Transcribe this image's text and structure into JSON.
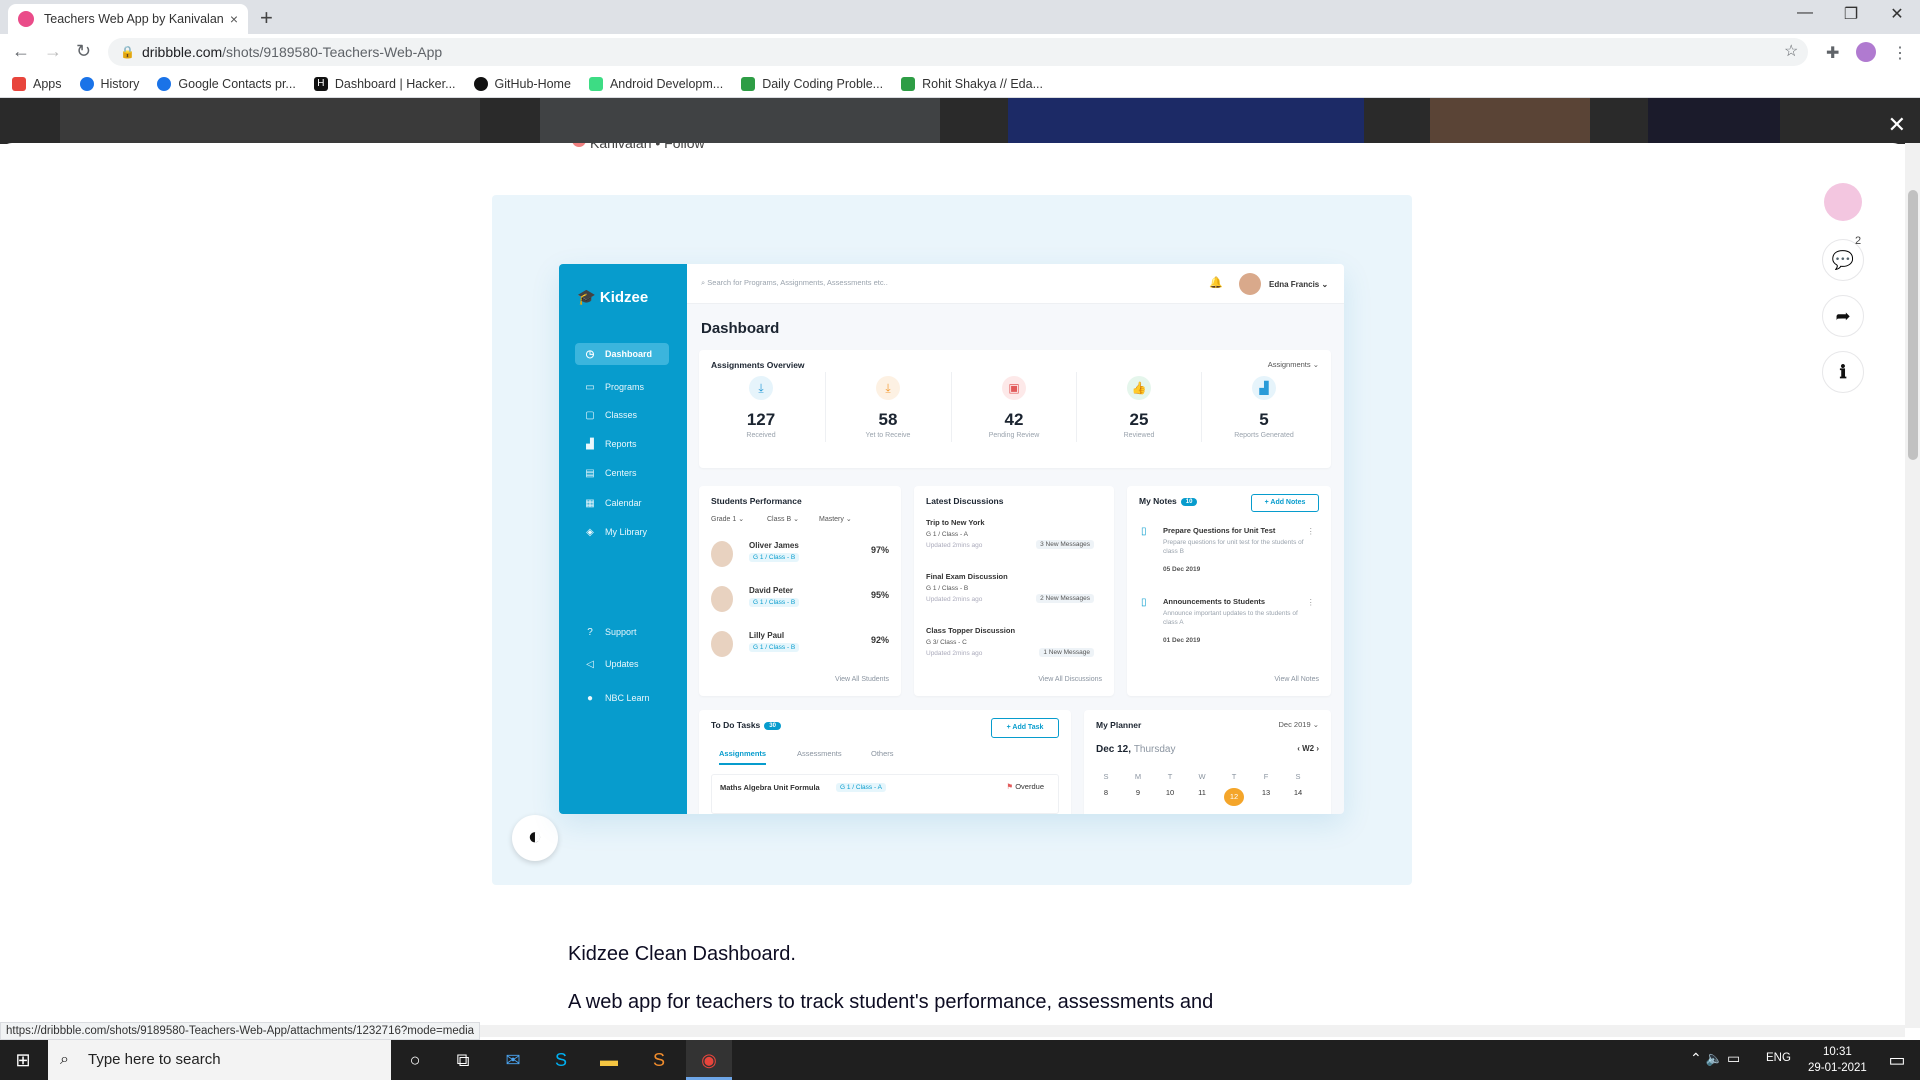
{
  "browser": {
    "tab_title": "Teachers Web App by Kanivalan",
    "tab_close": "×",
    "new_tab": "+",
    "url_host": "dribbble.com",
    "url_path": "/shots/9189580-Teachers-Web-App",
    "bookmarks": [
      {
        "label": "Apps",
        "color": "#e8453c"
      },
      {
        "label": "History",
        "color": "#1a73e8"
      },
      {
        "label": "Google Contacts pr...",
        "color": "#1a73e8"
      },
      {
        "label": "Dashboard | Hacker...",
        "color": "#111111"
      },
      {
        "label": "GitHub-Home",
        "color": "#111111"
      },
      {
        "label": "Android Developm...",
        "color": "#3ddc84"
      },
      {
        "label": "Daily Coding Proble...",
        "color": "#2e9d45"
      },
      {
        "label": "Rohit Shakya // Eda...",
        "color": "#2e9d45"
      }
    ]
  },
  "page": {
    "author": "Kanivalan • Follow",
    "comment_count": "2",
    "description_1": "Kidzee Clean Dashboard.",
    "description_2": "A web app for teachers to track student's performance, assessments and",
    "status_url": "https://dribbble.com/shots/9189580-Teachers-Web-App/attachments/1232716?mode=media"
  },
  "dashboard": {
    "brand": "Kidzee",
    "search_placeholder": "Search for Programs, Assignments, Assessments etc..",
    "user": "Edna Francis",
    "title": "Dashboard",
    "nav": [
      "Dashboard",
      "Programs",
      "Classes",
      "Reports",
      "Centers",
      "Calendar",
      "My Library"
    ],
    "nav_bottom": [
      "Support",
      "Updates",
      "NBC Learn"
    ],
    "overview_title": "Assignments Overview",
    "overview_filter": "Assignments",
    "stats": [
      {
        "value": "127",
        "label": "Received",
        "icon": "download-icon",
        "color": "#2a9bd8",
        "bg": "#e6f4fb"
      },
      {
        "value": "58",
        "label": "Yet to Receive",
        "icon": "pending-download-icon",
        "color": "#f39c34",
        "bg": "#fdf1e3"
      },
      {
        "value": "42",
        "label": "Pending Review",
        "icon": "review-icon",
        "color": "#e25a5a",
        "bg": "#fde9e9"
      },
      {
        "value": "25",
        "label": "Reviewed",
        "icon": "thumbs-up-icon",
        "color": "#3fb36b",
        "bg": "#e5f6ec"
      },
      {
        "value": "5",
        "label": "Reports Generated",
        "icon": "chart-icon",
        "color": "#2a9bd8",
        "bg": "#e6f4fb"
      }
    ],
    "performance_title": "Students Performance",
    "performance_filters": [
      "Grade 1",
      "Class B",
      "Mastery"
    ],
    "students": [
      {
        "name": "Oliver James",
        "class": "G 1 / Class - B",
        "pct": "97%"
      },
      {
        "name": "David Peter",
        "class": "G 1 / Class - B",
        "pct": "95%"
      },
      {
        "name": "Lilly Paul",
        "class": "G 1 / Class - B",
        "pct": "92%"
      }
    ],
    "view_all_students": "View All Students",
    "discussions_title": "Latest Discussions",
    "discussions": [
      {
        "title": "Trip to New York",
        "class": "G 1 / Class - A",
        "updated": "Updated 2mins ago",
        "messages": "3 New Messages"
      },
      {
        "title": "Final Exam Discussion",
        "class": "G 1 / Class - B",
        "updated": "Updated 2mins ago",
        "messages": "2 New Messages"
      },
      {
        "title": "Class Topper Discussion",
        "class": "G 3/ Class - C",
        "updated": "Updated 2mins ago",
        "messages": "1 New Message"
      }
    ],
    "view_all_discussions": "View All Discussions",
    "notes_title": "My Notes",
    "notes_count": "10",
    "add_notes": "+ Add Notes",
    "notes": [
      {
        "title": "Prepare Questions for Unit Test",
        "desc": "Prepare questions for unit test for the students of class B",
        "date": "05 Dec 2019"
      },
      {
        "title": "Announcements to Students",
        "desc": "Announce important updates to the students of class A",
        "date": "01 Dec 2019"
      }
    ],
    "view_all_notes": "View All Notes",
    "todo_title": "To Do Tasks",
    "todo_count": "30",
    "add_task": "+ Add Task",
    "todo_tabs": [
      "Assignments",
      "Assessments",
      "Others"
    ],
    "todo_item": "Maths Algebra Unit Formula",
    "todo_item_class": "G 1 / Class - A",
    "todo_item_status": "Overdue",
    "planner_title": "My Planner",
    "planner_month": "Dec 2019",
    "planner_date": "Dec 12,",
    "planner_day": "Thursday",
    "planner_week": "W2",
    "week_days": [
      "S",
      "M",
      "T",
      "W",
      "T",
      "F",
      "S"
    ],
    "week_dates": [
      "8",
      "9",
      "10",
      "11",
      "12",
      "13",
      "14"
    ]
  },
  "taskbar": {
    "search_placeholder": "Type here to search",
    "lang": "ENG",
    "time": "10:31",
    "date": "29-01-2021"
  }
}
